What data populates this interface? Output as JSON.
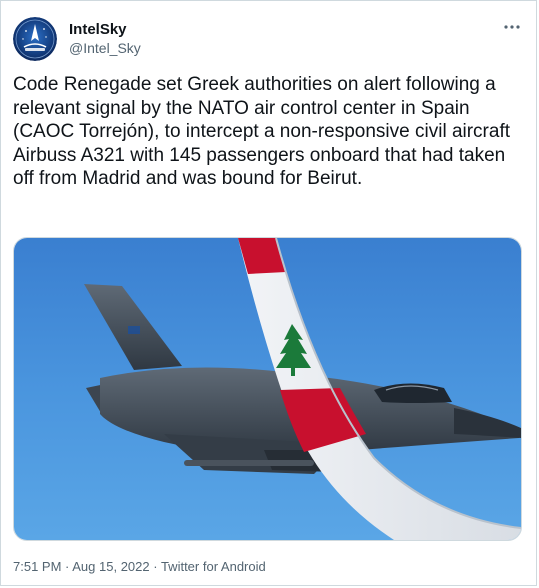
{
  "author": {
    "display_name": "IntelSky",
    "handle": "@Intel_Sky",
    "avatar_icon": "intelsky-logo-icon"
  },
  "more_icon": "more-dots-icon",
  "more_label": "···",
  "tweet": {
    "text": "Code Renegade set Greek authorities on alert following a relevant signal by the NATO air control center in Spain (CAOC Torrejón), to intercept a non-responsive civil aircraft Airbuss A321 with 145 passengers onboard that had taken off from Madrid and was bound for Beirut."
  },
  "media": {
    "description_icon": "fighter-jet-and-lebanese-wingtip-photo"
  },
  "meta": {
    "time": "7:51 PM",
    "separator_1": " · ",
    "date": "Aug 15, 2022",
    "separator_2": " · ",
    "source": "Twitter for Android"
  },
  "colors": {
    "text_primary": "#0f1419",
    "text_secondary": "#536471",
    "border": "#cfd9de",
    "sky": "#3f8fd6",
    "lebanon_red": "#c8102e"
  }
}
